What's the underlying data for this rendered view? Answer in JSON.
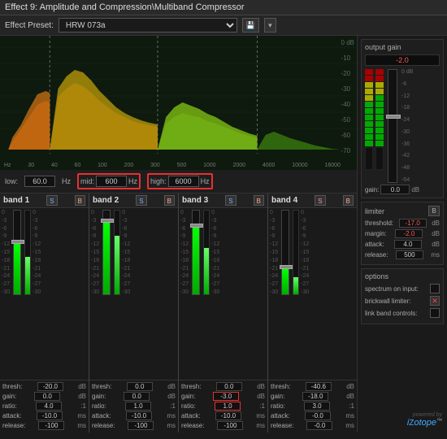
{
  "titleBar": {
    "text": "Effect 9: Amplitude and Compression\\Multiband Compressor"
  },
  "presetBar": {
    "label": "Effect Preset:",
    "value": "HRW 073a",
    "saveBtn": "💾",
    "menuBtn": "☰"
  },
  "spectrum": {
    "dbLabels": [
      "0 dB",
      "-10",
      "-20",
      "-30",
      "-40",
      "-50",
      "-60",
      "-70"
    ],
    "freqLabels": [
      "Hz",
      "30",
      "40",
      "60",
      "100",
      "200",
      "300",
      "500",
      "1000",
      "2000",
      "4000",
      "10000",
      "16000"
    ]
  },
  "crossover": {
    "lowLabel": "low:",
    "lowValue": "60.0",
    "lowUnit": "Hz",
    "midLabel": "mid:",
    "midValue": "600",
    "midUnit": "Hz",
    "highLabel": "high:",
    "highValue": "6000",
    "highUnit": "Hz"
  },
  "bands": [
    {
      "name": "band 1",
      "sBtn": "S",
      "bBtn": "B",
      "thresh": "-20.0",
      "gain": "0.0",
      "ratio": "4.0",
      "attack": "-10.0",
      "release": "-100",
      "threshUnit": "dB",
      "gainUnit": "dB",
      "ratioUnit": ":1",
      "attackUnit": "ms",
      "releaseUnit": "ms"
    },
    {
      "name": "band 2",
      "sBtn": "S",
      "bBtn": "B",
      "thresh": "0.0",
      "gain": "0.0",
      "ratio": "1.0",
      "attack": "-10.0",
      "release": "-100",
      "threshUnit": "dB",
      "gainUnit": "dB",
      "ratioUnit": ":1",
      "attackUnit": "ms",
      "releaseUnit": "ms"
    },
    {
      "name": "band 3",
      "sBtn": "S",
      "bBtn": "B",
      "thresh": "0.0",
      "gain": "-3.0",
      "ratio": "1.0",
      "attack": "-10.0",
      "release": "-100",
      "threshUnit": "dB",
      "gainUnit": "dB",
      "ratioUnit": ":1",
      "attackUnit": "ms",
      "releaseUnit": "ms",
      "gainHighlighted": true
    },
    {
      "name": "band 4",
      "sBtn": "S",
      "bBtn": "B",
      "thresh": "-40.6",
      "gain": "-18.0",
      "ratio": "3.0",
      "attack": "-0.0",
      "release": "-0.0",
      "threshUnit": "dB",
      "gainUnit": "dB",
      "ratioUnit": ":1",
      "attackUnit": "ms",
      "releaseUnit": "ms"
    }
  ],
  "outputGain": {
    "title": "output gain",
    "displayValue": "-2.0",
    "gainLabel": "gain:",
    "gainValue": "0.0",
    "gainUnit": "dB",
    "dbScale": [
      "0 dB",
      "-6",
      "-12",
      "-18",
      "-24",
      "-30",
      "-36",
      "-42",
      "-48",
      "-54"
    ]
  },
  "limiter": {
    "title": "limiter",
    "bBtn": "B",
    "threshold": {
      "label": "threshold:",
      "value": "-17.0",
      "unit": "dB"
    },
    "margin": {
      "label": "margin:",
      "value": "-2.0",
      "unit": "dB"
    },
    "attack": {
      "label": "attack:",
      "value": "4.0",
      "unit": "dB"
    },
    "release": {
      "label": "release:",
      "value": "500",
      "unit": "ms"
    }
  },
  "options": {
    "title": "options",
    "spectrumOnInput": {
      "label": "spectrum on input:",
      "checked": false
    },
    "brickwallLimiter": {
      "label": "brickwall limiter:",
      "checked": true
    },
    "linkBandControls": {
      "label": "link band controls:",
      "checked": false
    }
  },
  "izotopeLogo": {
    "text": "powered by",
    "brand": "iZotope"
  }
}
